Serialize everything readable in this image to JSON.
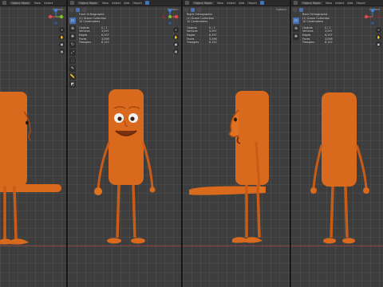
{
  "viewports": [
    {
      "header": {
        "mode": "Object Mode",
        "menus": [
          "View",
          "Select",
          "Add",
          "Object"
        ]
      },
      "options": "Options",
      "info": null,
      "navigation": {
        "x": "X",
        "y": "Y",
        "z": "Z"
      }
    },
    {
      "header": {
        "mode": "Object Mode",
        "menus": [
          "View",
          "Select",
          "Add",
          "Object"
        ]
      },
      "options": "Options",
      "info": {
        "view_name": "Front Orthographic",
        "collection": "(1) Scene Collection",
        "units": "10 Centimeters",
        "stats": [
          {
            "label": "Objects",
            "value": "0 / 1"
          },
          {
            "label": "Vertices",
            "value": "3,097"
          },
          {
            "label": "Edges",
            "value": "6,297"
          },
          {
            "label": "Faces",
            "value": "3,098"
          },
          {
            "label": "Triangles",
            "value": "6,152"
          }
        ]
      },
      "navigation": {
        "x": "X",
        "y": "Y",
        "z": "Z"
      }
    },
    {
      "header": {
        "mode": "Object Mode",
        "menus": [
          "View",
          "Select",
          "Add",
          "Object"
        ]
      },
      "options": "Options",
      "info": {
        "view_name": "Right Orthographic",
        "collection": "(1) Scene Collection",
        "units": "10 Centimeters",
        "stats": [
          {
            "label": "Objects",
            "value": "0 / 1"
          },
          {
            "label": "Vertices",
            "value": "3,097"
          },
          {
            "label": "Edges",
            "value": "6,297"
          },
          {
            "label": "Faces",
            "value": "3,098"
          },
          {
            "label": "Triangles",
            "value": "6,152"
          }
        ]
      },
      "navigation": {
        "x": "X",
        "y": "Y",
        "z": "Z"
      }
    },
    {
      "header": {
        "mode": "Object Mode",
        "menus": [
          "View",
          "Select",
          "Add",
          "Object"
        ]
      },
      "options": "Options",
      "info": {
        "view_name": "Back Orthographic",
        "collection": "(1) Scene Collection",
        "units": "10 Centimeters",
        "stats": [
          {
            "label": "Objects",
            "value": "0 / 1"
          },
          {
            "label": "Vertices",
            "value": "3,097"
          },
          {
            "label": "Edges",
            "value": "6,297"
          },
          {
            "label": "Faces",
            "value": "3,098"
          },
          {
            "label": "Triangles",
            "value": "6,152"
          }
        ]
      },
      "navigation": {
        "x": "X",
        "y": "Y",
        "z": "Z"
      }
    }
  ],
  "colors": {
    "character": "#d9691c",
    "character_shadow": "#a8480f",
    "viewport_bg": "#3d3d3d",
    "header_bg": "#2a2a2a",
    "accent": "#4772b3",
    "axis_x": "#e0494c",
    "axis_y": "#7fbf2a",
    "axis_z": "#3d84d9"
  }
}
